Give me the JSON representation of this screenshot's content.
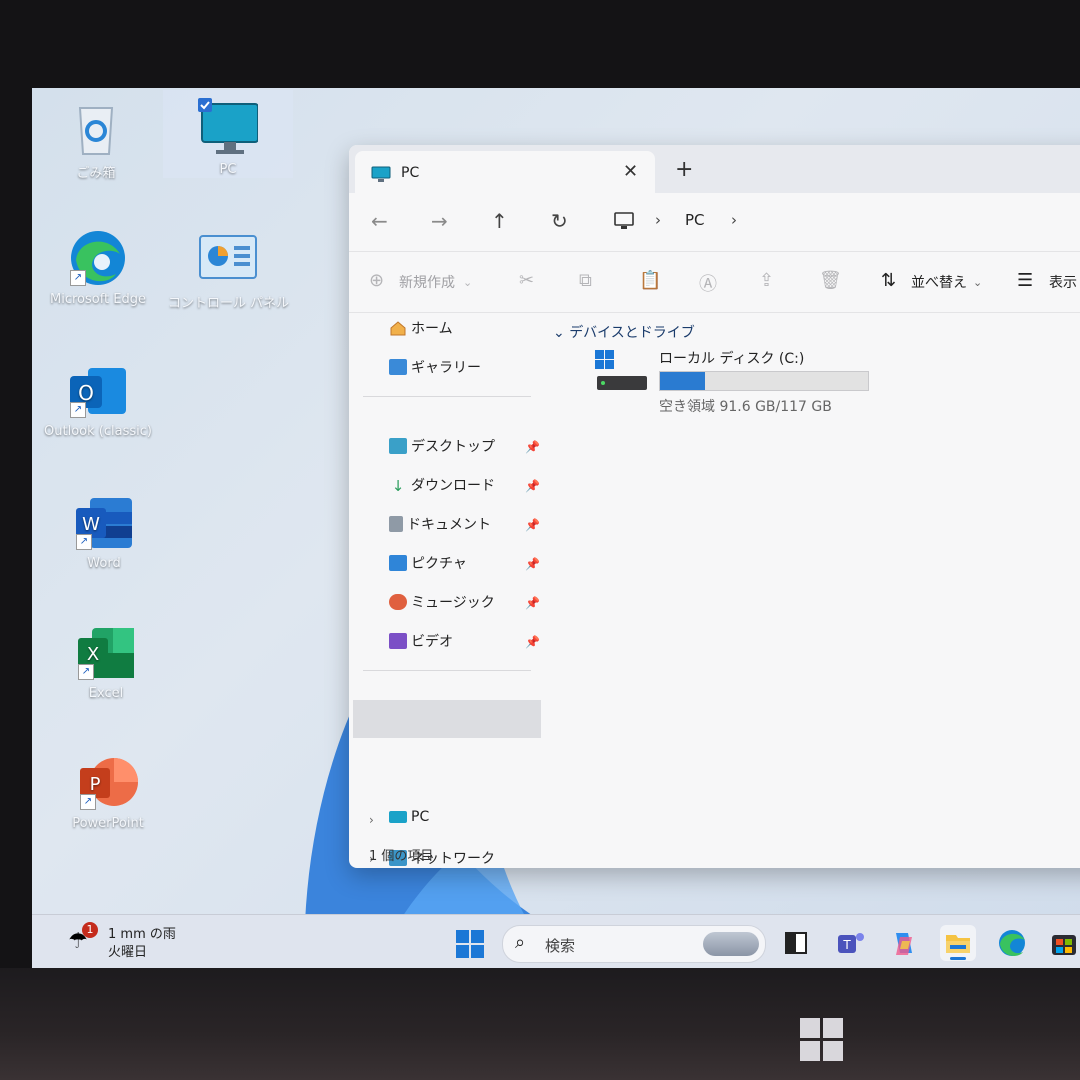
{
  "desktop": {
    "icons": [
      {
        "label": "ごみ箱",
        "icon": "recycle-bin-icon"
      },
      {
        "label": "PC",
        "icon": "pc-icon"
      },
      {
        "label": "Microsoft Edge",
        "icon": "edge-icon"
      },
      {
        "label": "コントロール パネル",
        "icon": "control-panel-icon"
      },
      {
        "label": "Outlook (classic)",
        "icon": "outlook-icon"
      },
      {
        "label": "Word",
        "icon": "word-icon"
      },
      {
        "label": "Excel",
        "icon": "excel-icon"
      },
      {
        "label": "PowerPoint",
        "icon": "powerpoint-icon"
      }
    ]
  },
  "explorer": {
    "tab_title": "PC",
    "breadcrumb": [
      "PC"
    ],
    "toolbar": {
      "new_label": "新規作成",
      "sort_label": "並べ替え",
      "view_label": "表示"
    },
    "sidebar": {
      "home": "ホーム",
      "gallery": "ギャラリー",
      "quick": [
        "デスクトップ",
        "ダウンロード",
        "ドキュメント",
        "ピクチャ",
        "ミュージック",
        "ビデオ"
      ],
      "pc": "PC",
      "network": "ネットワーク"
    },
    "section_title": "デバイスとドライブ",
    "drive": {
      "name": "ローカル ディスク (C:)",
      "free_text": "空き領域 91.6 GB/117 GB",
      "used_fraction": 0.217
    },
    "status": "1 個の項目"
  },
  "taskbar": {
    "weather_badge": "1",
    "weather_line1": "1 mm の雨",
    "weather_line2": "火曜日",
    "search_placeholder": "検索"
  },
  "colors": {
    "accent": "#1b77d6",
    "drive_bar": "#2a7bd1"
  }
}
